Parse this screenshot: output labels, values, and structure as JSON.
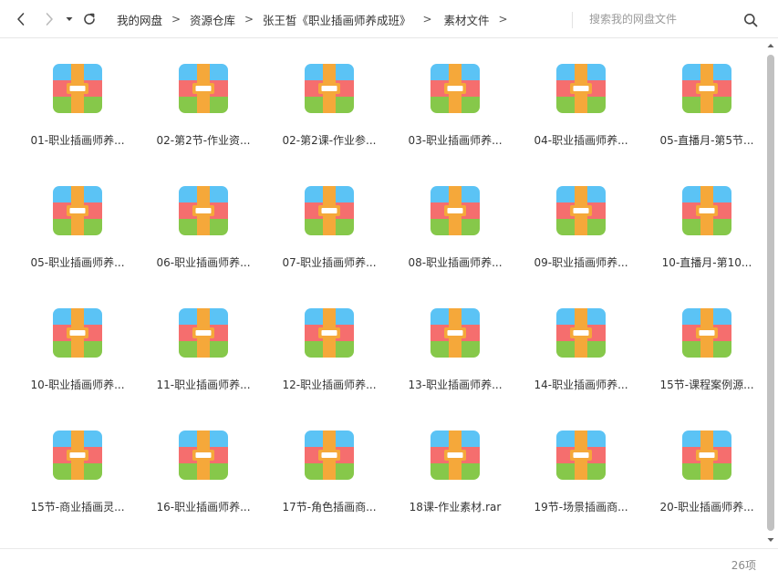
{
  "toolbar": {
    "back_icon": "chevron-left-icon",
    "forward_icon": "chevron-right-icon",
    "history_icon": "caret-down-icon",
    "refresh_icon": "refresh-icon",
    "breadcrumb": [
      "我的网盘",
      "资源仓库",
      "张王皙《职业插画师养成班》",
      "素材文件"
    ],
    "breadcrumb_separator": ">"
  },
  "search": {
    "placeholder": "搜索我的网盘文件",
    "value": "",
    "icon": "search-icon"
  },
  "files": [
    {
      "name": "01-职业插画师养..."
    },
    {
      "name": "02-第2节-作业资..."
    },
    {
      "name": "02-第2课-作业参..."
    },
    {
      "name": "03-职业插画师养..."
    },
    {
      "name": "04-职业插画师养..."
    },
    {
      "name": "05-直播月-第5节..."
    },
    {
      "name": "05-职业插画师养..."
    },
    {
      "name": "06-职业插画师养..."
    },
    {
      "name": "07-职业插画师养..."
    },
    {
      "name": "08-职业插画师养..."
    },
    {
      "name": "09-职业插画师养..."
    },
    {
      "name": "10-直播月-第10..."
    },
    {
      "name": "10-职业插画师养..."
    },
    {
      "name": "11-职业插画师养..."
    },
    {
      "name": "12-职业插画师养..."
    },
    {
      "name": "13-职业插画师养..."
    },
    {
      "name": "14-职业插画师养..."
    },
    {
      "name": "15节-课程案例源..."
    },
    {
      "name": "15节-商业插画灵..."
    },
    {
      "name": "16-职业插画师养..."
    },
    {
      "name": "17节-角色插画商..."
    },
    {
      "name": "18课-作业素材.rar"
    },
    {
      "name": "19节-场景插画商..."
    },
    {
      "name": "20-职业插画师养..."
    }
  ],
  "file_icon": "archive-icon",
  "archive_colors": {
    "top": "#5bc3f5",
    "middle": "#f56e6e",
    "bottom": "#86c84a",
    "strap": "#f5a83a",
    "buckle": "#ffffff"
  },
  "status": {
    "count": "26项"
  },
  "colors": {
    "text": "#333333",
    "muted": "#8a8a8a",
    "border": "#e6e6e6"
  }
}
